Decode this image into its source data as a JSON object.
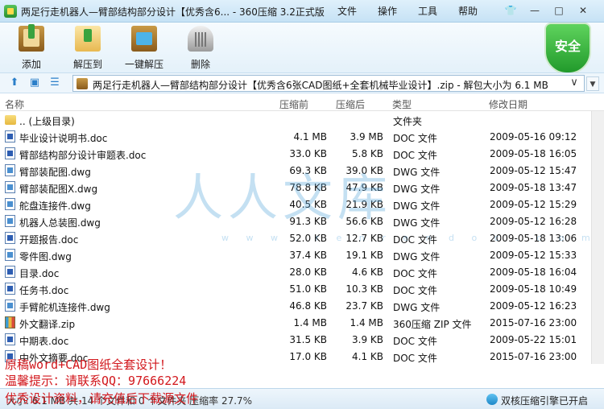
{
  "window": {
    "title": "两足行走机器人—臂部结构部分设计【优秀含6... - 360压缩 3.2正式版"
  },
  "menu": [
    "文件",
    "操作",
    "工具",
    "帮助"
  ],
  "toolbar": {
    "add": "添加",
    "extract_to": "解压到",
    "one_click_extract": "一键解压",
    "delete": "删除"
  },
  "security_badge": "安全",
  "address": {
    "text": "两足行走机器人—臂部结构部分设计【优秀含6张CAD图纸+全套机械毕业设计】.zip - 解包大小为 6.1 MB"
  },
  "columns": {
    "name": "名称",
    "packed": "压缩前",
    "size": "压缩后",
    "type": "类型",
    "modified": "修改日期"
  },
  "files": [
    {
      "icon": "folder",
      "name": ".. (上级目录)",
      "packed": "",
      "size": "",
      "type": "文件夹",
      "modified": ""
    },
    {
      "icon": "doc",
      "name": "毕业设计说明书.doc",
      "packed": "4.1 MB",
      "size": "3.9 MB",
      "type": "DOC 文件",
      "modified": "2009-05-16 09:12"
    },
    {
      "icon": "doc",
      "name": "臂部结构部分设计审题表.doc",
      "packed": "33.0 KB",
      "size": "5.8 KB",
      "type": "DOC 文件",
      "modified": "2009-05-18 16:05"
    },
    {
      "icon": "dwg",
      "name": "臂部装配图.dwg",
      "packed": "69.3 KB",
      "size": "39.0 KB",
      "type": "DWG 文件",
      "modified": "2009-05-12 15:47"
    },
    {
      "icon": "dwg",
      "name": "臂部装配图X.dwg",
      "packed": "78.8 KB",
      "size": "47.9 KB",
      "type": "DWG 文件",
      "modified": "2009-05-18 13:47"
    },
    {
      "icon": "dwg",
      "name": "舵盘连接件.dwg",
      "packed": "40.5 KB",
      "size": "21.9 KB",
      "type": "DWG 文件",
      "modified": "2009-05-12 15:29"
    },
    {
      "icon": "dwg",
      "name": "机器人总装图.dwg",
      "packed": "91.3 KB",
      "size": "56.6 KB",
      "type": "DWG 文件",
      "modified": "2009-05-12 16:28"
    },
    {
      "icon": "doc",
      "name": "开题报告.doc",
      "packed": "52.0 KB",
      "size": "12.7 KB",
      "type": "DOC 文件",
      "modified": "2009-05-18 13:06"
    },
    {
      "icon": "dwg",
      "name": "零件图.dwg",
      "packed": "37.4 KB",
      "size": "19.1 KB",
      "type": "DWG 文件",
      "modified": "2009-05-12 15:33"
    },
    {
      "icon": "doc",
      "name": "目录.doc",
      "packed": "28.0 KB",
      "size": "4.6 KB",
      "type": "DOC 文件",
      "modified": "2009-05-18 16:04"
    },
    {
      "icon": "doc",
      "name": "任务书.doc",
      "packed": "51.0 KB",
      "size": "10.3 KB",
      "type": "DOC 文件",
      "modified": "2009-05-18 10:49"
    },
    {
      "icon": "dwg",
      "name": "手臂舵机连接件.dwg",
      "packed": "46.8 KB",
      "size": "23.7 KB",
      "type": "DWG 文件",
      "modified": "2009-05-12 16:23"
    },
    {
      "icon": "zip",
      "name": "外文翻译.zip",
      "packed": "1.4 MB",
      "size": "1.4 MB",
      "type": "360压缩 ZIP 文件",
      "modified": "2015-07-16 23:00"
    },
    {
      "icon": "doc",
      "name": "中期表.doc",
      "packed": "31.5 KB",
      "size": "3.9 KB",
      "type": "DOC 文件",
      "modified": "2009-05-22 15:01"
    },
    {
      "icon": "doc",
      "name": "中外文摘要.doc",
      "packed": "17.0 KB",
      "size": "4.1 KB",
      "type": "DOC 文件",
      "modified": "2015-07-16 23:00"
    }
  ],
  "watermark": {
    "main": "人人文库",
    "sub": "w w w . r e n r e n d o c . c o m"
  },
  "overlay": {
    "line1": "原稿word+CAD图纸全套设计！",
    "line2": "温馨提示：请联系QQ：97666224",
    "line3": "优秀设计资料，请充值后下载源文件"
  },
  "status": {
    "left": "大小: 6.1 MB 共 14 个文件和 0 个文件夹 压缩率 27.7%",
    "right": "双核压缩引擎已开启"
  }
}
